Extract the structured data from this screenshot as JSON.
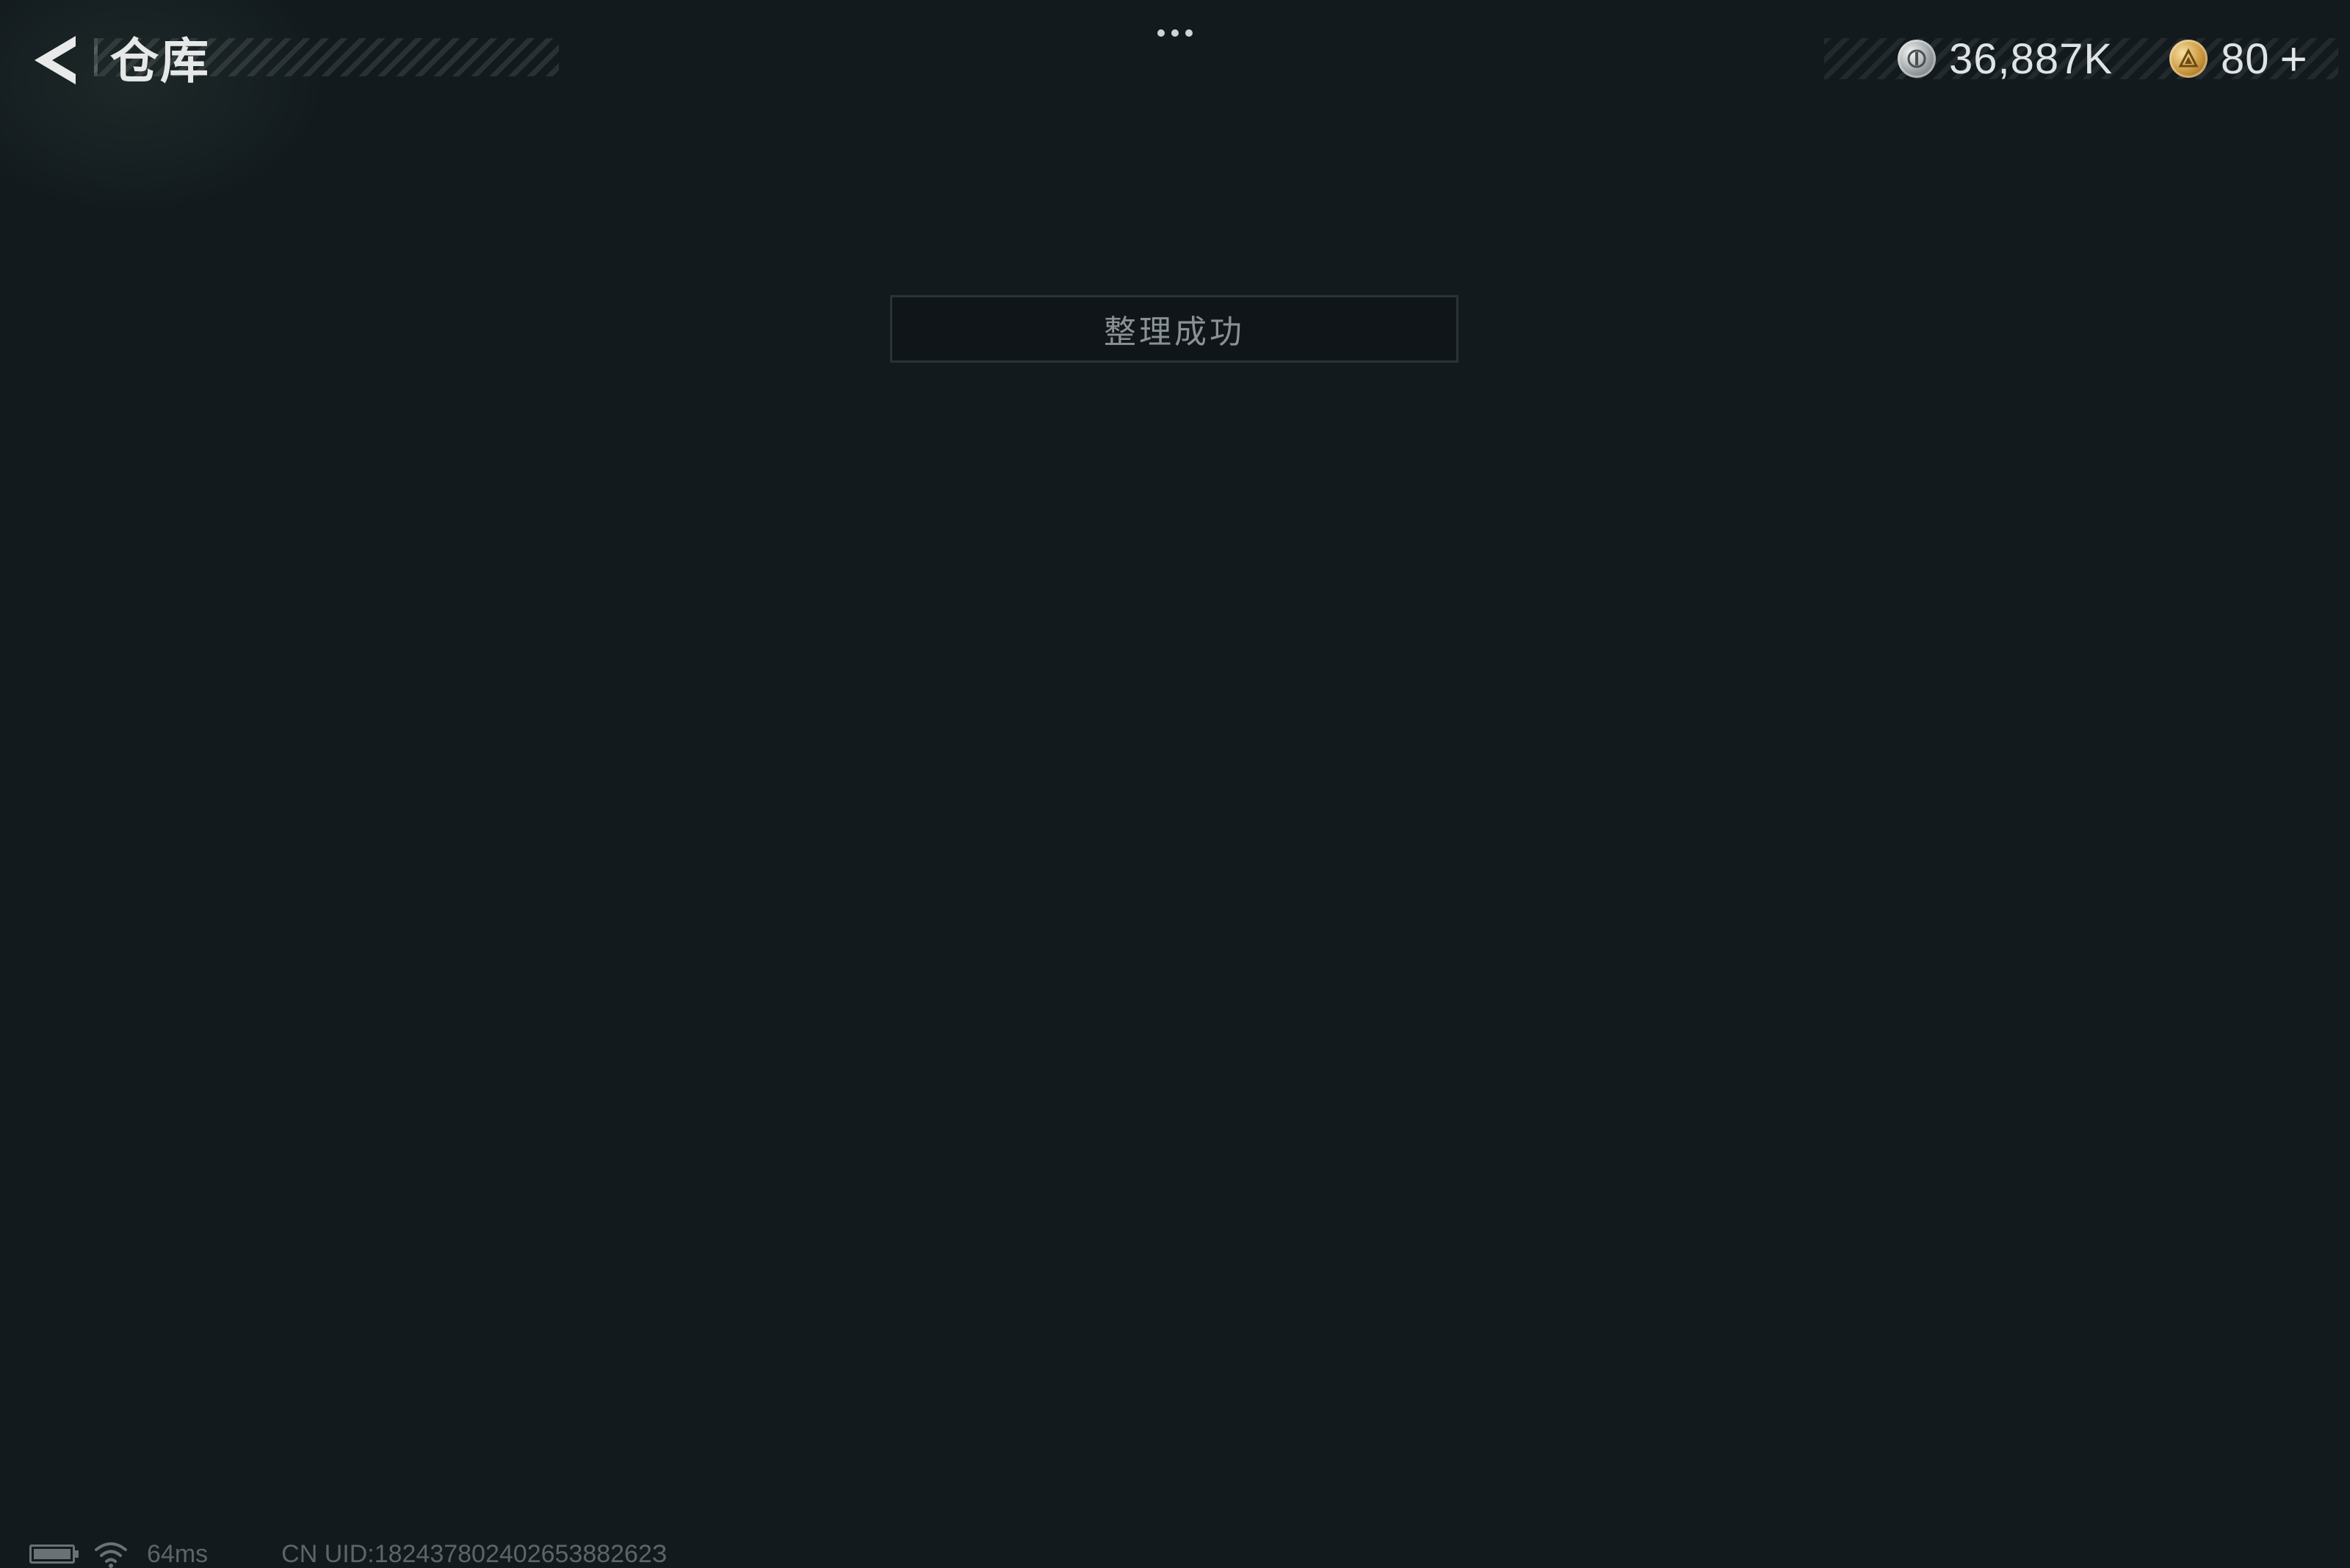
{
  "header": {
    "title": "仓库",
    "more_menu_icon": "ellipsis-icon"
  },
  "currencies": [
    {
      "icon": "silver-coin-icon",
      "value": "36,887K"
    },
    {
      "icon": "gold-coin-icon",
      "value": "80",
      "action": "+"
    }
  ],
  "toast": {
    "message": "整理成功"
  },
  "status": {
    "battery_icon": "battery-icon",
    "wifi_icon": "wifi-icon",
    "latency": "64ms",
    "uid": "CN UID:18243780240265388262З"
  },
  "colors": {
    "background": "#121a1e",
    "text_primary": "#e6e8e8",
    "toast_text": "#8a9194",
    "status_text": "#5d6569"
  }
}
